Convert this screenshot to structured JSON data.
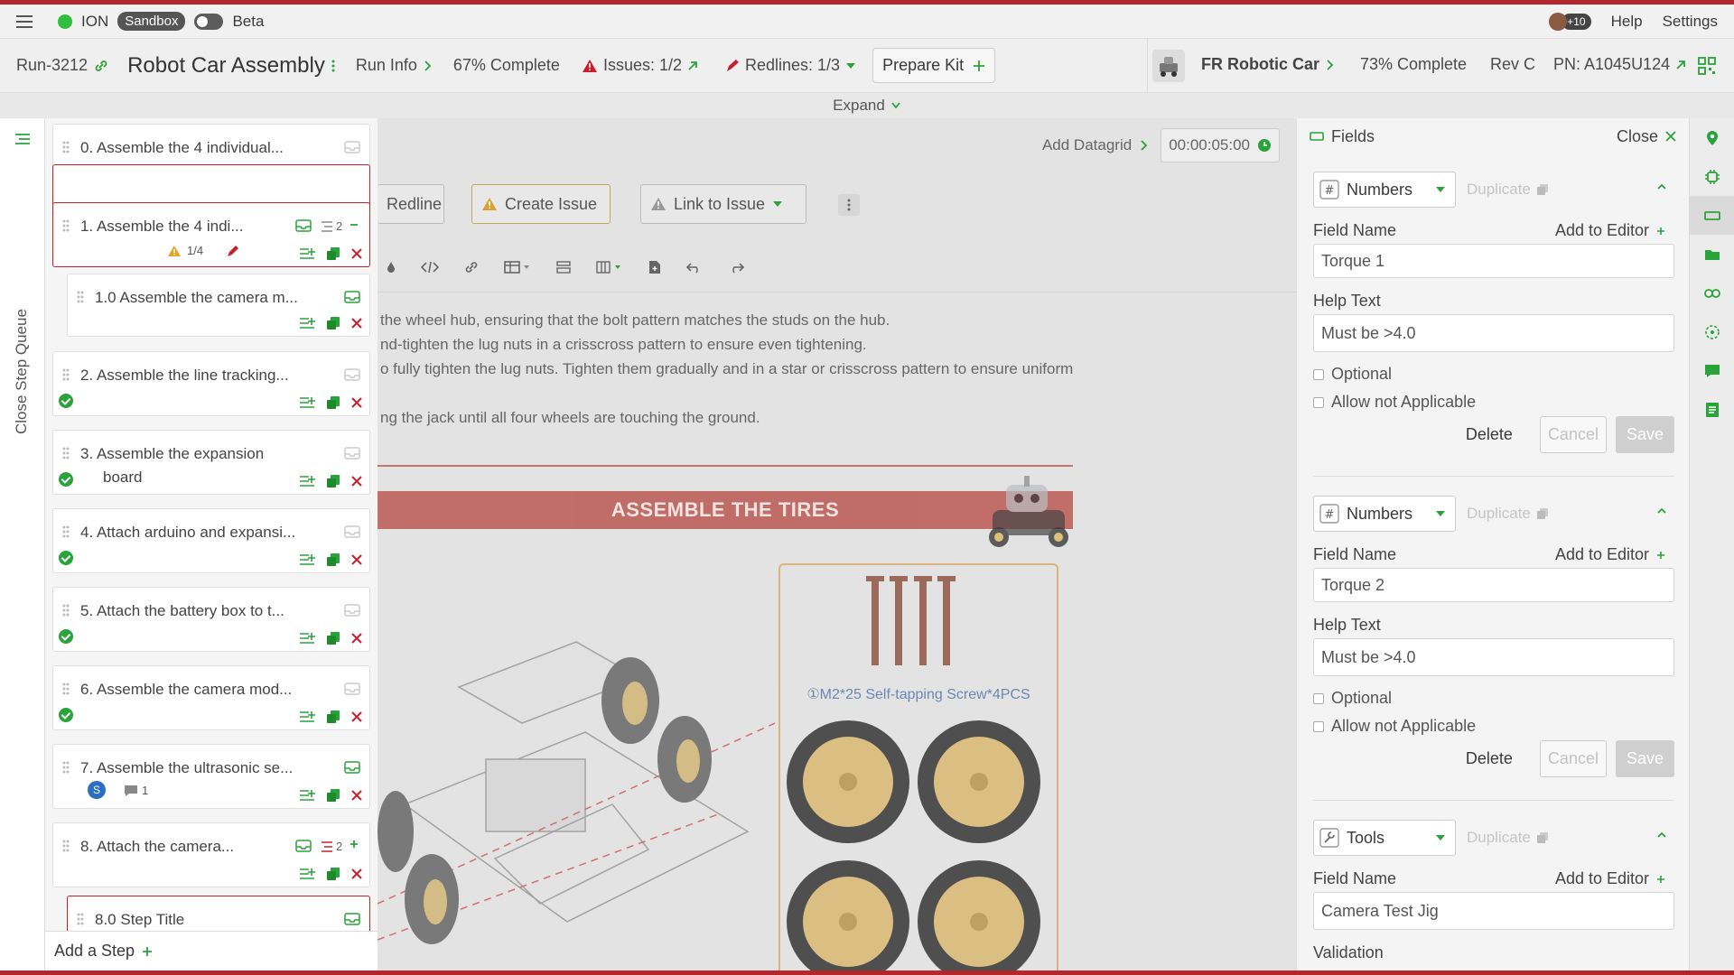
{
  "topbar": {
    "env": "ION",
    "sandbox": "Sandbox",
    "beta": "Beta",
    "avatar_count": "+10",
    "help": "Help",
    "settings": "Settings"
  },
  "header": {
    "run_id": "Run-3212",
    "title": "Robot Car Assembly",
    "run_info": "Run Info",
    "complete": "67% Complete",
    "issues": "Issues: 1/2",
    "redlines": "Redlines: 1/3",
    "prepare_kit": "Prepare Kit",
    "product": "FR Robotic Car",
    "product_complete": "73% Complete",
    "rev": "Rev C",
    "pn": "PN: A1045U124"
  },
  "expand": "Expand",
  "queue": {
    "label": "Close Step Queue",
    "add_step": "Add a Step",
    "steps": [
      {
        "title": "0.  Assemble the 4 individual..."
      },
      {
        "title": "1.  Assemble the 4 indi...",
        "count": "2",
        "issues": "1/4"
      },
      {
        "title": "1.0  Assemble the camera m..."
      },
      {
        "title": "2.  Assemble the line tracking..."
      },
      {
        "title": "3.  Assemble the expansion",
        "title2": "board"
      },
      {
        "title": "4.  Attach arduino and expansi..."
      },
      {
        "title": "5.  Attach the battery box to t..."
      },
      {
        "title": "6.  Assemble the camera mod..."
      },
      {
        "title": "7.  Assemble the ultrasonic se...",
        "avatar": "S",
        "comments": "1"
      },
      {
        "title": "8.  Attach the camera...",
        "count": "2"
      },
      {
        "title": "8.0  Step Title"
      }
    ]
  },
  "editor": {
    "add_datagrid": "Add Datagrid",
    "timer": "00:00:05:00",
    "redline": "Redline",
    "create_issue": "Create Issue",
    "link_issue": "Link to Issue",
    "lines": [
      "the wheel hub, ensuring that the bolt pattern matches the studs on the hub.",
      "nd-tighten the lug nuts in a crisscross pattern to ensure even tightening.",
      "o fully tighten the lug nuts. Tighten them gradually and in a star or crisscross pattern to ensure uniform",
      "",
      "ng the jack until all four wheels are touching the ground."
    ],
    "banner": "ASSEMBLE THE TIRES",
    "screw_caption": "①M2*25 Self-tapping Screw*4PCS"
  },
  "fields": {
    "title": "Fields",
    "close": "Close",
    "duplicate": "Duplicate",
    "field_name_label": "Field Name",
    "help_text_label": "Help Text",
    "add_to_editor": "Add to Editor",
    "optional": "Optional",
    "allow_na": "Allow not Applicable",
    "delete": "Delete",
    "cancel": "Cancel",
    "save": "Save",
    "validation": "Validation",
    "groups": [
      {
        "type": "Numbers",
        "name": "Torque 1",
        "help": "Must be >4.0"
      },
      {
        "type": "Numbers",
        "name": "Torque 2",
        "help": "Must be >4.0"
      },
      {
        "type": "Tools",
        "name": "Camera Test Jig"
      }
    ]
  },
  "colors": {
    "accent_red": "#c8202a",
    "green": "#2aa33a",
    "brand_stripe": "#b3262b"
  }
}
